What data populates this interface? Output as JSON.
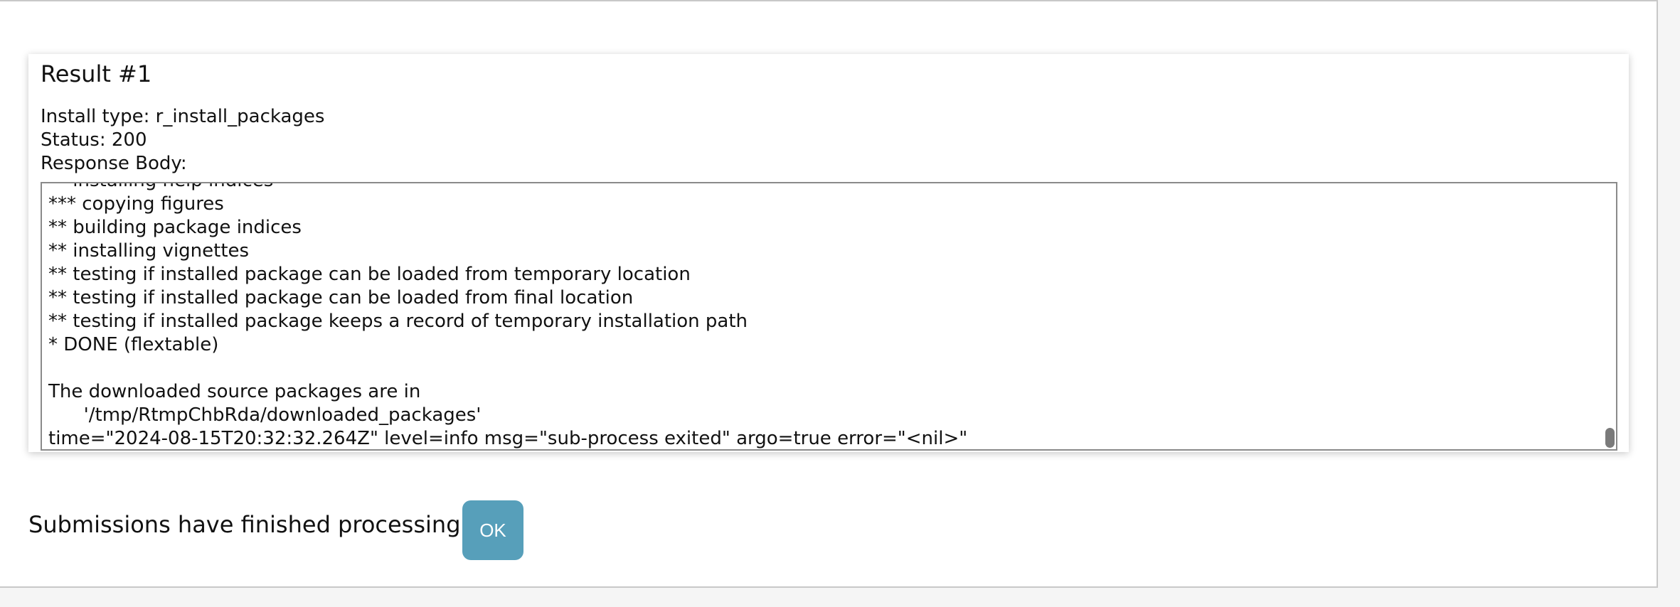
{
  "result": {
    "title": "Result #1",
    "install_type": "Install type: r_install_packages",
    "status": "Status: 200",
    "response_label": "Response Body:",
    "response_lines": [
      "** installing help indices",
      "*** copying figures",
      "** building package indices",
      "** installing vignettes",
      "** testing if installed package can be loaded from temporary location",
      "** testing if installed package can be loaded from final location",
      "** testing if installed package keeps a record of temporary installation path",
      "* DONE (flextable)",
      "",
      "The downloaded source packages are in",
      "      '/tmp/RtmpChbRda/downloaded_packages'",
      "time=\"2024-08-15T20:32:32.264Z\" level=info msg=\"sub-process exited\" argo=true error=\"<nil>\""
    ]
  },
  "footer": {
    "message": "Submissions have finished processing.",
    "ok_label": "OK"
  },
  "colors": {
    "ok_button": "#579fba"
  }
}
